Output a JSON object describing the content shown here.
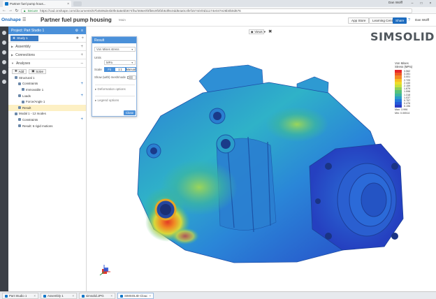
{
  "browser": {
    "tab_title": "Partner fuel pump hous...",
    "window_user": "Dan Wolff",
    "secure_label": "Secure",
    "url": "https://cad.onshape.com/documents/57b4506de4b0fe3a5ebb674f/w/466e0f4fb8c9f3f2b53f8c0dd54a0c4fef1574/e/0d11174e047e26b0b0d676"
  },
  "appbar": {
    "logo": "Onshape",
    "doc_title": "Partner fuel pump housing",
    "doc_subtitle": "Main",
    "app_store_label": "App Store",
    "learning_label": "Learning Center",
    "share_label": "Share",
    "user_label": "Dan Wolff"
  },
  "panel": {
    "header": "Project: Part Studio 1",
    "study_tab": "Study 1",
    "sections": {
      "assembly": "Assembly",
      "connections": "Connections",
      "analyses": "Analyses"
    },
    "toolbar": {
      "add_label": "Add",
      "solve_label": "Solve"
    },
    "tree": [
      {
        "label": "Structural 1",
        "indent": 1,
        "plus": false,
        "selected": false
      },
      {
        "label": "Constraints",
        "indent": 2,
        "plus": true,
        "selected": false
      },
      {
        "label": "Immovable 1",
        "indent": 3,
        "plus": false,
        "selected": false
      },
      {
        "label": "Loads",
        "indent": 2,
        "plus": true,
        "selected": false
      },
      {
        "label": "Force/Angle 1",
        "indent": 3,
        "plus": false,
        "selected": false
      },
      {
        "label": "Result",
        "indent": 2,
        "plus": false,
        "selected": true
      },
      {
        "label": "Modal 1 - 12 modes",
        "indent": 1,
        "plus": false,
        "selected": false
      },
      {
        "label": "Constraints",
        "indent": 2,
        "plus": true,
        "selected": false
      },
      {
        "label": "Result: 6 rigid motions",
        "indent": 2,
        "plus": false,
        "selected": false
      }
    ]
  },
  "viewport": {
    "view_label": "Views",
    "brand": "SIMSOLID"
  },
  "dialog": {
    "title": "Result",
    "result_type": "Von Mises stress",
    "units_label": "Units",
    "units_value": "MPa",
    "scale_label": "Scale",
    "scale_options": [
      "Fit",
      "1:1",
      "Manual"
    ],
    "scale_selected": 0,
    "show_mesh_label": "Show (with) mesh/node",
    "deformation_label": "Deformation options",
    "legend_label": "Legend options",
    "close_label": "Close"
  },
  "legend": {
    "title_line1": "Von Mises",
    "title_line2": "Stress (MPa)",
    "colors": [
      "#e4262b",
      "#ef5a26",
      "#f38a24",
      "#f7bc23",
      "#eedc2a",
      "#c7e03c",
      "#8fd05a",
      "#57c27a",
      "#3bb5a0",
      "#2a9cc9",
      "#2478d9",
      "#2459d9",
      "#2a3bc4"
    ],
    "values": [
      "3.562",
      "3.281",
      "3.001",
      "2.720",
      "2.440",
      "2.159",
      "1.879",
      "1.598",
      "1.318",
      "1.037",
      "0.757",
      "0.476",
      "0.196"
    ],
    "max_label": "Max: 3.996",
    "min_label": "Min: 0.00514"
  },
  "taskbar": {
    "tasks": [
      {
        "label": "Part Studio 1",
        "active": false
      },
      {
        "label": "Assembly 1",
        "active": false
      },
      {
        "label": "simsolid.JPG",
        "active": false
      },
      {
        "label": "SIMSOLID Cloud",
        "active": true
      }
    ]
  }
}
